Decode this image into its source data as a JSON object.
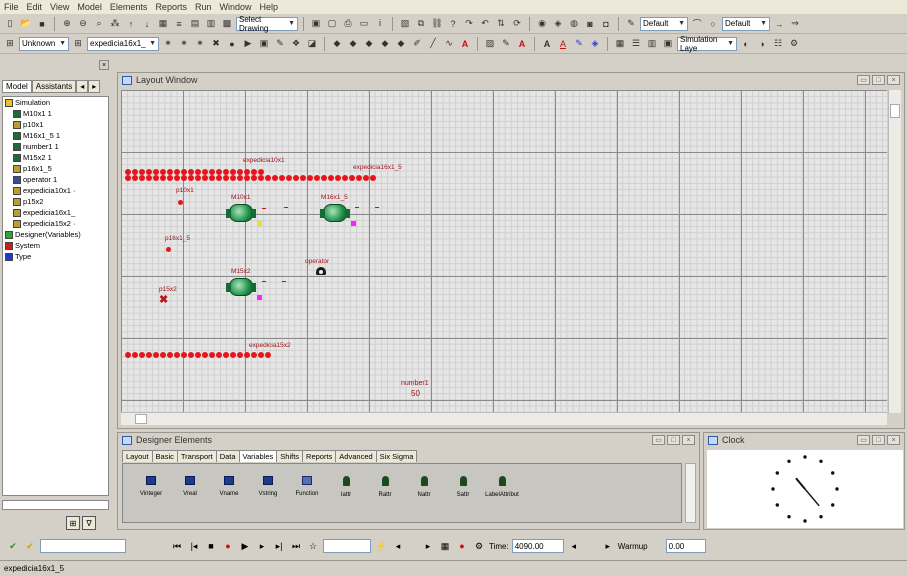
{
  "menu": [
    "File",
    "Edit",
    "View",
    "Model",
    "Elements",
    "Reports",
    "Run",
    "Window",
    "Help"
  ],
  "toolbar1": {
    "select_drawing": "Select Drawing",
    "style_combo_1": "Default",
    "style_combo_2": "Default"
  },
  "toolbar2": {
    "category_combo": "Unknown",
    "element_combo": "expedicia16x1_",
    "layer_combo": "Simulation Laye"
  },
  "left_panel": {
    "tabs": [
      "Model",
      "Assistants"
    ],
    "tree": [
      {
        "label": "Simulation",
        "color": "#f0c020"
      },
      {
        "label": "M10x1 1",
        "color": "#1f6a3a"
      },
      {
        "label": "p10x1",
        "color": "#b8a030"
      },
      {
        "label": "M16x1_5 1",
        "color": "#1f6a3a"
      },
      {
        "label": "number1 1",
        "color": "#1f6a3a"
      },
      {
        "label": "M15x2 1",
        "color": "#1f6a3a"
      },
      {
        "label": "p16x1_5",
        "color": "#b8a030"
      },
      {
        "label": "operator 1",
        "color": "#3a4aa0"
      },
      {
        "label": "expedicia10x1 ·",
        "color": "#b8a030"
      },
      {
        "label": "p15x2",
        "color": "#b8a030"
      },
      {
        "label": "expedicia16x1_",
        "color": "#b8a030"
      },
      {
        "label": "expedicia15x2 ·",
        "color": "#b8a030"
      },
      {
        "label": "Designer(Variables)",
        "color": "#2aa82a"
      },
      {
        "label": "System",
        "color": "#d21a1a"
      },
      {
        "label": "Type",
        "color": "#1a3ad2"
      }
    ]
  },
  "layout_window": {
    "title": "Layout Window",
    "labels": {
      "q1": "expedicia10x1",
      "q2": "expedicia16x1_5",
      "q3": "expedicia15x2",
      "p10": "p10x1",
      "p16": "p16x1_5",
      "p15": "p15x2",
      "m10": "M10x1",
      "m16": "M16x1_5",
      "m15": "M15x2",
      "op": "operator",
      "num": "number1",
      "num_value": "50"
    }
  },
  "designer": {
    "title": "Designer Elements",
    "tabs": [
      "Layout",
      "Basic",
      "Transport",
      "Data",
      "Variables",
      "Shifts",
      "Reports",
      "Advanced",
      "Six Sigma"
    ],
    "active_tab": "Variables",
    "items": [
      {
        "label": "Vinteger",
        "kind": "var"
      },
      {
        "label": "Vreal",
        "kind": "var"
      },
      {
        "label": "Vname",
        "kind": "var"
      },
      {
        "label": "Vstring",
        "kind": "var"
      },
      {
        "label": "Function",
        "kind": "fun"
      },
      {
        "label": "Iattr",
        "kind": "att"
      },
      {
        "label": "Rattr",
        "kind": "att"
      },
      {
        "label": "Nattr",
        "kind": "att"
      },
      {
        "label": "Sattr",
        "kind": "att"
      },
      {
        "label": "LabelAttribut",
        "kind": "att"
      }
    ]
  },
  "clock": {
    "title": "Clock",
    "hour_hand_deg": 320,
    "minute_hand_deg": 140
  },
  "runbar": {
    "time_label": "Time:",
    "time_value": "4090.00",
    "warmup_label": "Warmup",
    "warmup_value": "0.00"
  },
  "status": {
    "text": "expedicia16x1_5"
  }
}
